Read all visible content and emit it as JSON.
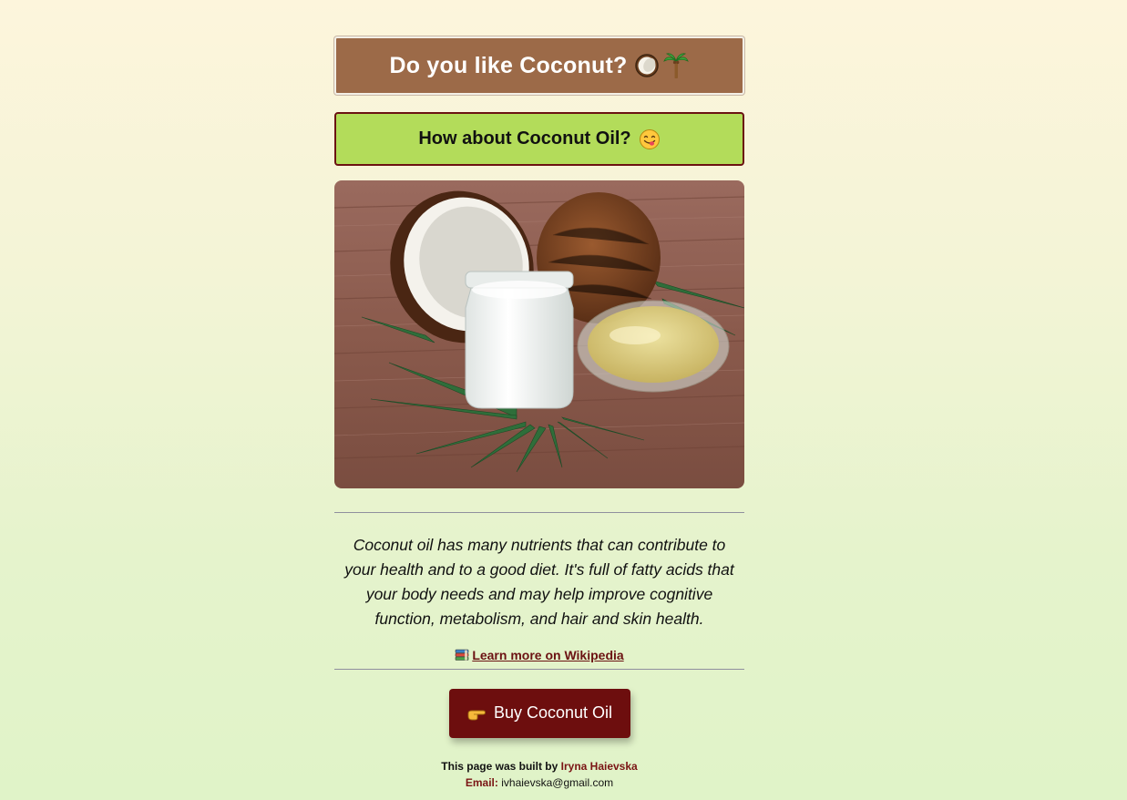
{
  "header": {
    "title": "Do you like Coconut?",
    "subtitle": "How about Coconut Oil?"
  },
  "photo": {
    "alt": "Coconut oil jar with coconuts and palm leaf"
  },
  "content": {
    "description": "Coconut oil has many nutrients that can contribute to your health and to a good diet. It's full of fatty acids that your body needs and may help improve cognitive function, metabolism, and hair and skin health.",
    "wiki_link": "Learn more on Wikipedia"
  },
  "cta": {
    "buy_label": "Buy Coconut Oil"
  },
  "footer": {
    "built_by_text": "This page was built by ",
    "author": "Iryna Haievska",
    "email_label": "Email:",
    "email": "ivhaievska@gmail.com"
  },
  "colors": {
    "title_bg": "#9c6a48",
    "subtitle_bg": "#b3dc5a",
    "accent": "#6d0e0e"
  },
  "icons": {
    "title": [
      "coconut-icon",
      "palm-tree-icon"
    ],
    "subtitle": [
      "yum-face-icon"
    ],
    "wiki": "books-icon",
    "buy": "pointing-hand-icon"
  }
}
